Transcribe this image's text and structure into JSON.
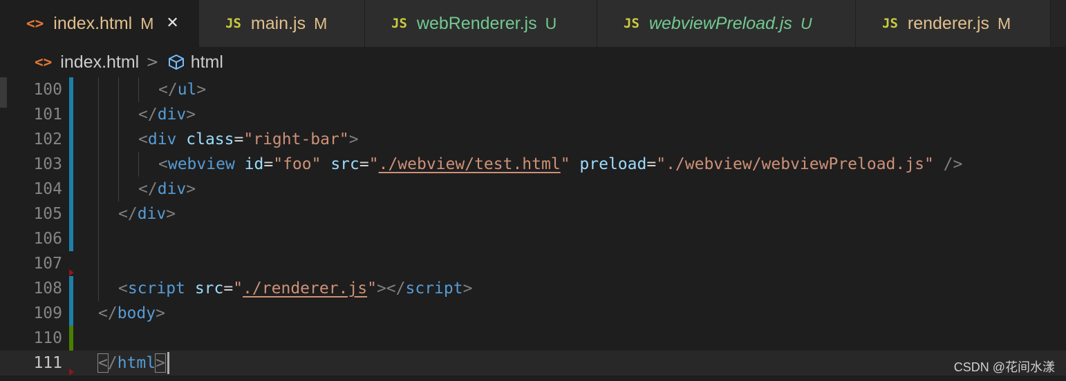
{
  "tabs": [
    {
      "label": "index.html",
      "status": "M",
      "icon": "html-file-icon",
      "icon_glyph": "<>",
      "active": true
    },
    {
      "label": "main.js",
      "status": "M",
      "icon": "js-file-icon",
      "icon_glyph": "JS"
    },
    {
      "label": "webRenderer.js",
      "status": "U",
      "icon": "js-file-icon",
      "icon_glyph": "JS"
    },
    {
      "label": "webviewPreload.js",
      "status": "U",
      "icon": "js-file-icon",
      "icon_glyph": "JS"
    },
    {
      "label": "renderer.js",
      "status": "M",
      "icon": "js-file-icon",
      "icon_glyph": "JS"
    }
  ],
  "close_glyph": "✕",
  "breadcrumb": {
    "file": "index.html",
    "file_icon_glyph": "<>",
    "separator": ">",
    "symbol": "html"
  },
  "colors": {
    "modified": "#e2c08d",
    "untracked": "#73c991",
    "html_icon": "#e37933",
    "js_icon": "#cbcb41",
    "gutter_modified": "#1b81a8",
    "gutter_added": "#487e02",
    "gutter_deleted": "#94151b"
  },
  "lines": [
    {
      "num": "100",
      "tokens": [
        [
          "</",
          "p"
        ],
        [
          "ul",
          "t"
        ],
        [
          ">",
          "p"
        ]
      ]
    },
    {
      "num": "101",
      "tokens": [
        [
          "</",
          "p"
        ],
        [
          "div",
          "t"
        ],
        [
          ">",
          "p"
        ]
      ]
    },
    {
      "num": "102",
      "tokens": [
        [
          "<",
          "p"
        ],
        [
          "div",
          "t"
        ],
        [
          " ",
          "e"
        ],
        [
          "class",
          "a"
        ],
        [
          "=",
          "e"
        ],
        [
          "\"right-bar\"",
          "s"
        ],
        [
          ">",
          "p"
        ]
      ]
    },
    {
      "num": "103",
      "tokens": [
        [
          "<",
          "p"
        ],
        [
          "webview",
          "t"
        ],
        [
          " ",
          "e"
        ],
        [
          "id",
          "a"
        ],
        [
          "=",
          "e"
        ],
        [
          "\"foo\"",
          "s"
        ],
        [
          " ",
          "e"
        ],
        [
          "src",
          "a"
        ],
        [
          "=",
          "e"
        ],
        [
          "\"",
          "s"
        ],
        [
          "./webview/test.html",
          "su"
        ],
        [
          "\"",
          "s"
        ],
        [
          " ",
          "e"
        ],
        [
          "preload",
          "a"
        ],
        [
          "=",
          "e"
        ],
        [
          "\"./webview/webviewPreload.js\"",
          "s"
        ],
        [
          " />",
          "p"
        ]
      ]
    },
    {
      "num": "104",
      "tokens": [
        [
          "</",
          "p"
        ],
        [
          "div",
          "t"
        ],
        [
          ">",
          "p"
        ]
      ]
    },
    {
      "num": "105",
      "tokens": [
        [
          "</",
          "p"
        ],
        [
          "div",
          "t"
        ],
        [
          ">",
          "p"
        ]
      ]
    },
    {
      "num": "106",
      "tokens": []
    },
    {
      "num": "107",
      "tokens": []
    },
    {
      "num": "108",
      "tokens": [
        [
          "<",
          "p"
        ],
        [
          "script",
          "t"
        ],
        [
          " ",
          "e"
        ],
        [
          "src",
          "a"
        ],
        [
          "=",
          "e"
        ],
        [
          "\"",
          "s"
        ],
        [
          "./renderer.js",
          "su"
        ],
        [
          "\"",
          "s"
        ],
        [
          "></",
          "p"
        ],
        [
          "script",
          "t"
        ],
        [
          ">",
          "p"
        ]
      ]
    },
    {
      "num": "109",
      "tokens": [
        [
          "</",
          "p"
        ],
        [
          "body",
          "t"
        ],
        [
          ">",
          "p"
        ]
      ]
    },
    {
      "num": "110",
      "tokens": []
    },
    {
      "num": "111",
      "tokens": [
        [
          "<",
          "pb"
        ],
        [
          "/",
          "p"
        ],
        [
          "html",
          "t"
        ],
        [
          ">",
          "pb"
        ]
      ]
    }
  ],
  "current_line": "111",
  "watermark": "CSDN @花间水漾"
}
